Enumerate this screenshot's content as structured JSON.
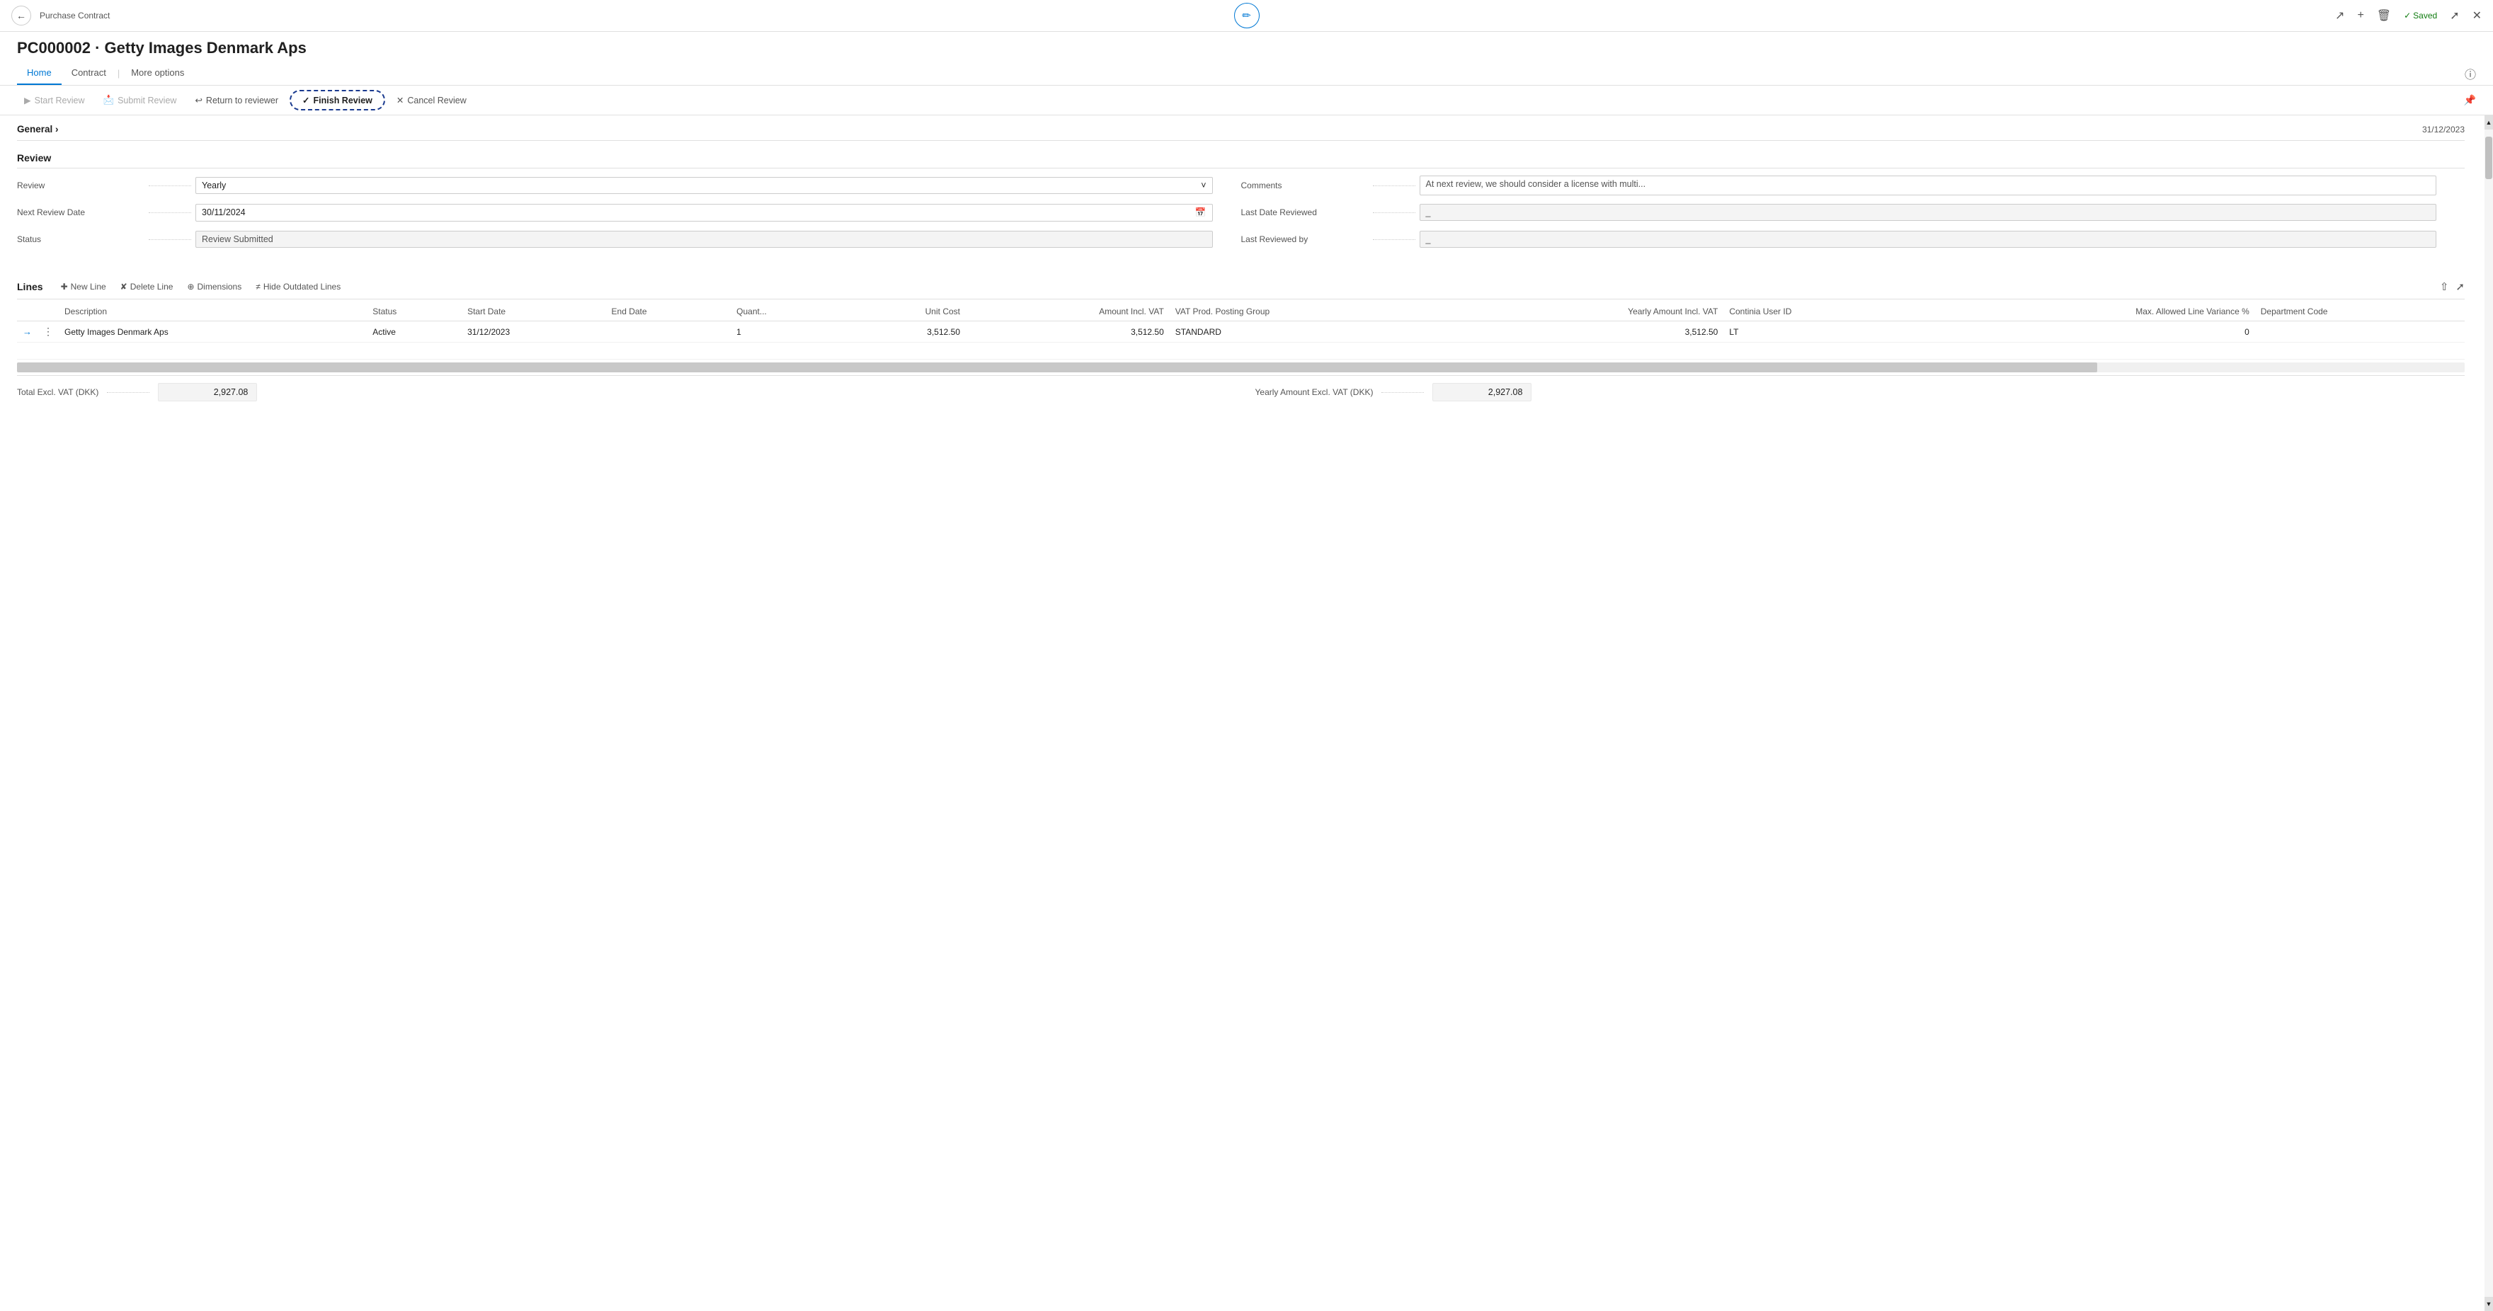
{
  "topbar": {
    "breadcrumb": "Purchase Contract",
    "saved_label": "Saved",
    "edit_icon": "✏",
    "share_icon": "⬆",
    "add_icon": "+",
    "delete_icon": "🗑",
    "expand_icon": "⤢",
    "collapse_icon": "⤡",
    "back_icon": "←"
  },
  "page": {
    "title": "PC000002 · Getty Images Denmark Aps"
  },
  "tabs": [
    {
      "label": "Home",
      "active": true
    },
    {
      "label": "Contract",
      "active": false
    },
    {
      "label": "More options",
      "active": false
    }
  ],
  "toolbar": {
    "start_review": "Start Review",
    "submit_review": "Submit Review",
    "return_to_reviewer": "Return to reviewer",
    "finish_review": "Finish Review",
    "cancel_review": "Cancel Review"
  },
  "general": {
    "title": "General",
    "date": "31/12/2023"
  },
  "review_section": {
    "title": "Review",
    "fields": {
      "review_label": "Review",
      "review_value": "Yearly",
      "next_review_date_label": "Next Review Date",
      "next_review_date_value": "30/11/2024",
      "status_label": "Status",
      "status_value": "Review Submitted",
      "comments_label": "Comments",
      "comments_value": "At next review, we should consider a license with multi...",
      "last_date_reviewed_label": "Last Date Reviewed",
      "last_date_reviewed_value": "_",
      "last_reviewed_by_label": "Last Reviewed by",
      "last_reviewed_by_value": "_"
    }
  },
  "lines_section": {
    "title": "Lines",
    "new_line_label": "New Line",
    "delete_line_label": "Delete Line",
    "dimensions_label": "Dimensions",
    "hide_outdated_label": "Hide Outdated Lines",
    "columns": [
      {
        "label": "Description"
      },
      {
        "label": "Status"
      },
      {
        "label": "Start Date"
      },
      {
        "label": "End Date"
      },
      {
        "label": "Quant..."
      },
      {
        "label": "Unit Cost",
        "right": true
      },
      {
        "label": "Amount Incl. VAT",
        "right": true
      },
      {
        "label": "VAT Prod. Posting Group"
      },
      {
        "label": "Yearly Amount Incl. VAT",
        "right": true
      },
      {
        "label": "Continia User ID"
      },
      {
        "label": "Max. Allowed Line Variance %",
        "right": true
      },
      {
        "label": "Department Code"
      }
    ],
    "rows": [
      {
        "description": "Getty Images Denmark Aps",
        "status": "Active",
        "start_date": "31/12/2023",
        "end_date": "",
        "quantity": "1",
        "unit_cost": "3,512.50",
        "amount_incl_vat": "3,512.50",
        "vat_prod_posting_group": "STANDARD",
        "yearly_amount_incl_vat": "3,512.50",
        "continia_user_id": "LT",
        "max_allowed_variance": "0",
        "department_code": ""
      }
    ]
  },
  "footer": {
    "total_excl_vat_label": "Total Excl. VAT (DKK)",
    "total_excl_vat_value": "2,927.08",
    "yearly_amount_excl_vat_label": "Yearly Amount Excl. VAT (DKK)",
    "yearly_amount_excl_vat_value": "2,927.08"
  }
}
